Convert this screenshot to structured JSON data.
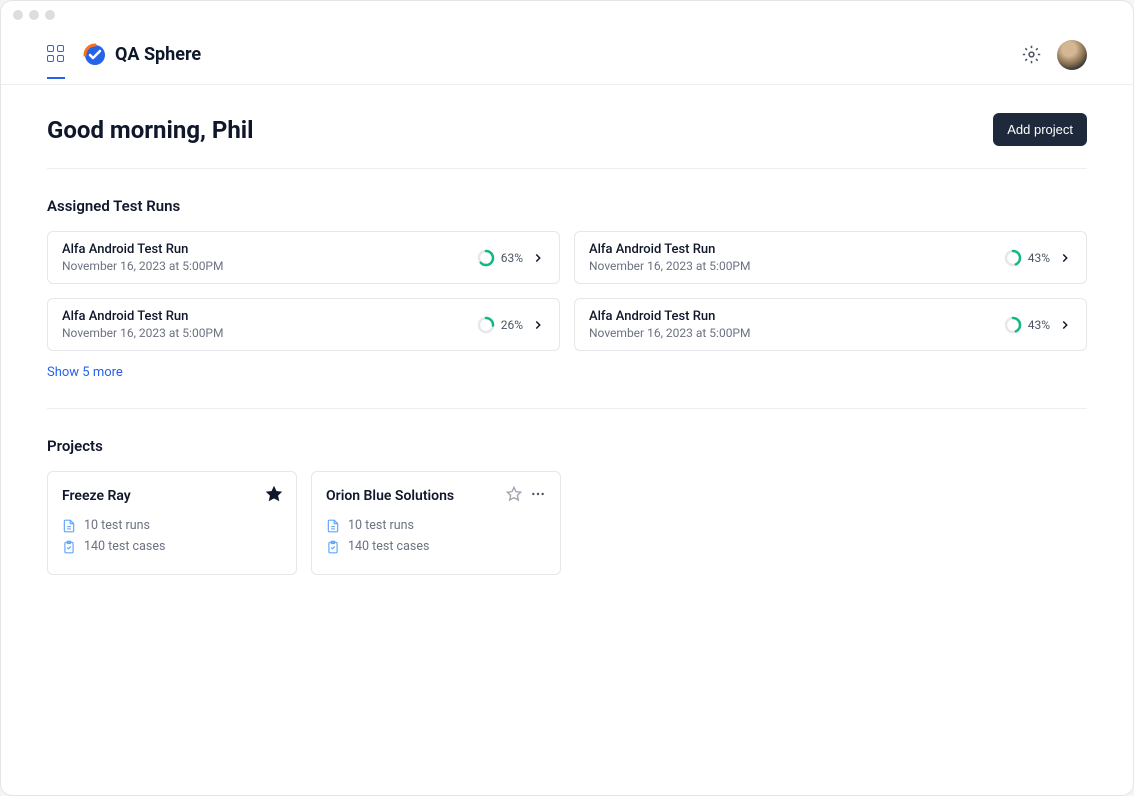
{
  "brand": "QA Sphere",
  "greeting": "Good morning, Phil",
  "add_project_label": "Add project",
  "sections": {
    "runs_title": "Assigned Test Runs",
    "projects_title": "Projects"
  },
  "show_more_label": "Show 5 more",
  "test_runs": [
    {
      "name": "Alfa Android Test Run",
      "date": "November 16, 2023 at 5:00PM",
      "progress_pct": "63%",
      "progress_val": 63
    },
    {
      "name": "Alfa Android Test Run",
      "date": "November 16, 2023 at 5:00PM",
      "progress_pct": "43%",
      "progress_val": 43
    },
    {
      "name": "Alfa Android Test Run",
      "date": "November 16, 2023 at 5:00PM",
      "progress_pct": "26%",
      "progress_val": 26
    },
    {
      "name": "Alfa Android Test Run",
      "date": "November 16, 2023 at 5:00PM",
      "progress_pct": "43%",
      "progress_val": 43
    }
  ],
  "projects": [
    {
      "name": "Freeze Ray",
      "runs": "10 test runs",
      "cases": "140 test cases",
      "starred": true
    },
    {
      "name": "Orion Blue Solutions",
      "runs": "10 test runs",
      "cases": "140 test cases",
      "starred": false
    }
  ],
  "colors": {
    "progress_ring": "#10b981",
    "accent_blue": "#2563eb"
  }
}
